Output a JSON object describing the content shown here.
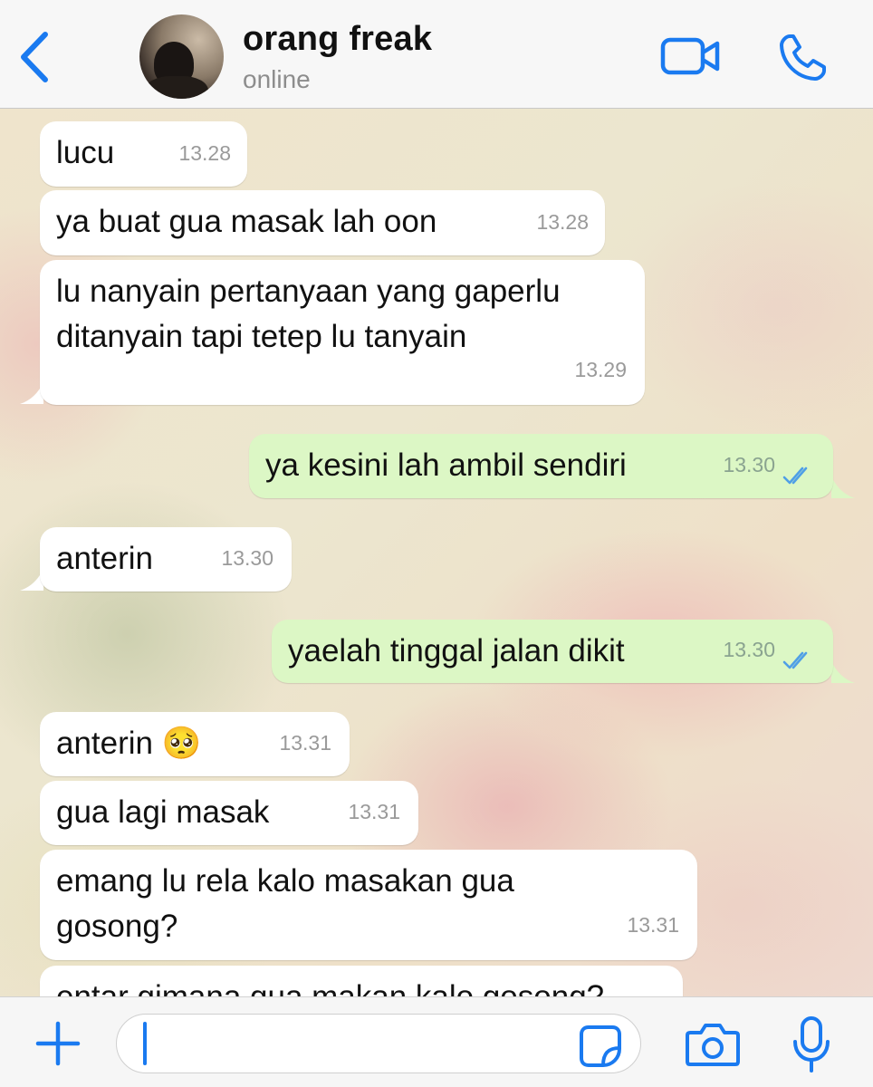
{
  "header": {
    "contact_name": "orang freak",
    "status": "online",
    "accent_color": "#1a7af0",
    "icons": [
      "back-chevron-icon",
      "video-call-icon",
      "phone-call-icon"
    ]
  },
  "messages": [
    {
      "direction": "in",
      "text": "lucu",
      "time": "13.28"
    },
    {
      "direction": "in",
      "text": "ya buat gua masak lah oon",
      "time": "13.28"
    },
    {
      "direction": "in",
      "text": "lu nanyain pertanyaan yang gaperlu ditanyain tapi tetep lu tanyain",
      "time": "13.29"
    },
    {
      "direction": "out",
      "text": "ya kesini lah ambil sendiri",
      "time": "13.30",
      "status": "read"
    },
    {
      "direction": "in",
      "text": "anterin",
      "time": "13.30"
    },
    {
      "direction": "out",
      "text": "yaelah tinggal jalan dikit",
      "time": "13.30",
      "status": "read"
    },
    {
      "direction": "in",
      "text": "anterin 🥺",
      "time": "13.31"
    },
    {
      "direction": "in",
      "text": "gua lagi masak",
      "time": "13.31"
    },
    {
      "direction": "in",
      "text": "emang lu rela kalo masakan gua gosong?",
      "time": "13.31"
    },
    {
      "direction": "in",
      "text": "entar gimana gua makan kalo gosong?",
      "time": ""
    }
  ],
  "input": {
    "value": "",
    "icons": [
      "plus-icon",
      "sticker-icon",
      "camera-icon",
      "microphone-icon"
    ]
  },
  "colors": {
    "incoming_bubble": "#ffffff",
    "outgoing_bubble": "#dcf7c5",
    "read_tick": "#4f9fe6"
  }
}
